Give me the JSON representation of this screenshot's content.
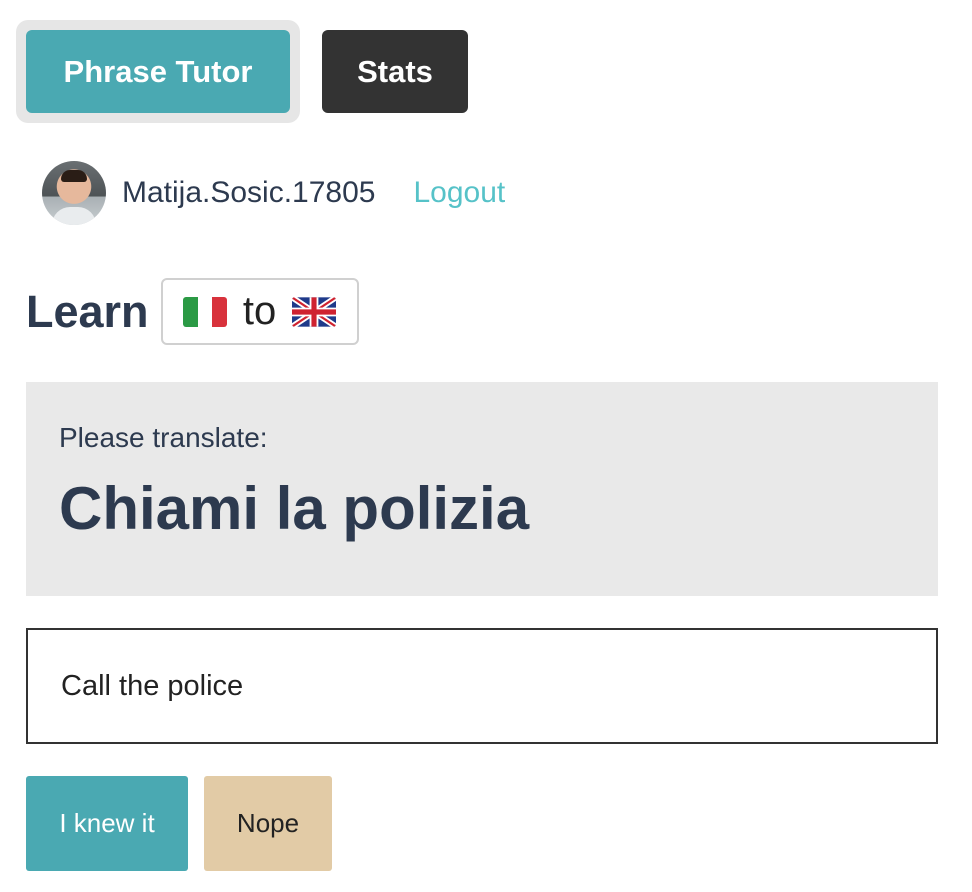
{
  "nav": {
    "tutor_label": "Phrase Tutor",
    "stats_label": "Stats"
  },
  "user": {
    "name": "Matija.Sosic.17805",
    "logout_label": "Logout"
  },
  "learn": {
    "title": "Learn",
    "from_flag": "italy-flag-icon",
    "to_label": "to",
    "to_flag": "uk-flag-icon"
  },
  "prompt": {
    "label": "Please translate:",
    "phrase": "Chiami la polizia"
  },
  "answer": {
    "value": "Call the police"
  },
  "actions": {
    "knew_label": "I knew it",
    "nope_label": "Nope"
  },
  "colors": {
    "accent_teal": "#4aa9b2",
    "dark_tab": "#333333",
    "link": "#56c2c8",
    "nope_bg": "#e2cba6",
    "text": "#2d3a4f"
  }
}
